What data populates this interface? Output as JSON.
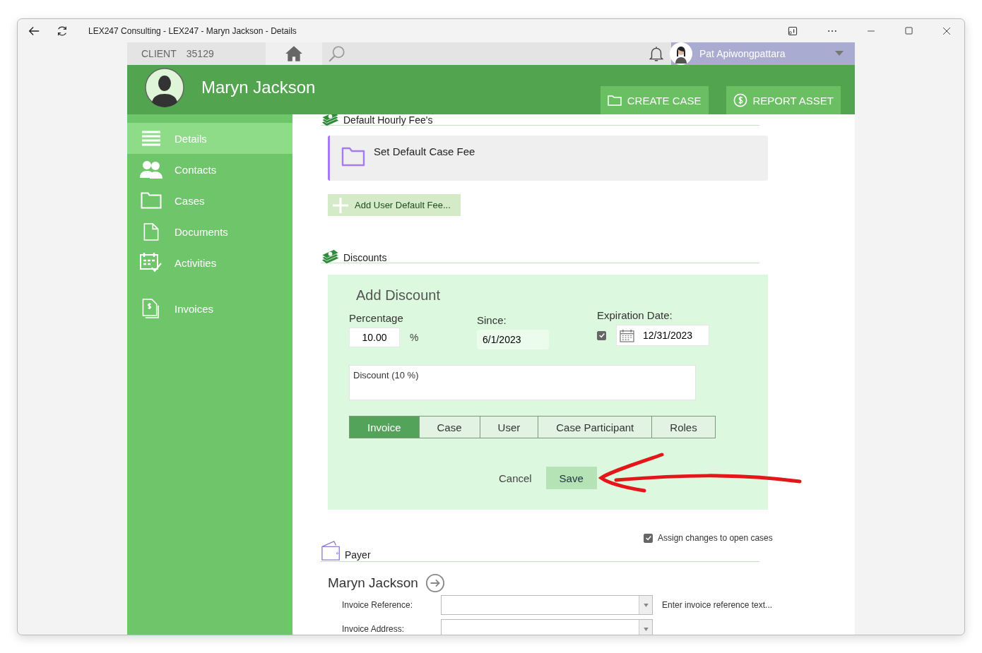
{
  "window": {
    "title": "LEX247 Consulting - LEX247 - Maryn Jackson - Details"
  },
  "topbar": {
    "client_label": "CLIENT",
    "client_number": "35129",
    "user_name": "Pat Apiwongpattara"
  },
  "header": {
    "client_name": "Maryn Jackson",
    "buttons": [
      {
        "label": "CREATE CASE",
        "kind": "case"
      },
      {
        "label": "REPORT ASSET",
        "kind": "asset"
      }
    ]
  },
  "sidebar": {
    "items": [
      {
        "label": "Details",
        "kind": "details",
        "selected": true
      },
      {
        "label": "Contacts",
        "kind": "contacts",
        "selected": false
      },
      {
        "label": "Cases",
        "kind": "cases",
        "selected": false
      },
      {
        "label": "Documents",
        "kind": "documents",
        "selected": false
      },
      {
        "label": "Activities",
        "kind": "activities",
        "selected": false
      },
      {
        "label": "Invoices",
        "kind": "invoices",
        "selected": false
      }
    ]
  },
  "fees": {
    "title": "Default Hourly Fee's",
    "default_case_fee": "Set Default Case Fee",
    "add_button": "Add User Default Fee..."
  },
  "discounts": {
    "title": "Discounts",
    "form": {
      "heading": "Add Discount",
      "percentage_label": "Percentage",
      "percentage_value": "10.00",
      "percent_sign": "%",
      "since_label": "Since:",
      "since_value": "6/1/2023",
      "expiration_checked": true,
      "expiration_label": "Expiration Date:",
      "expiration_value": "12/31/2023",
      "description": "Discount (10 %)",
      "scope_tabs": [
        {
          "label": "Invoice",
          "selected": true
        },
        {
          "label": "Case",
          "selected": false
        },
        {
          "label": "User",
          "selected": false
        },
        {
          "label": "Case Participant",
          "selected": false
        },
        {
          "label": "Roles",
          "selected": false
        }
      ],
      "cancel": "Cancel",
      "save": "Save"
    }
  },
  "payer": {
    "title": "Payer",
    "assign": {
      "label": "Assign changes to open cases",
      "checked": true
    },
    "name": "Maryn Jackson",
    "fields": [
      {
        "label": "Invoice Reference:",
        "hint": "Enter invoice reference text..."
      },
      {
        "label": "Invoice Address:"
      }
    ]
  }
}
